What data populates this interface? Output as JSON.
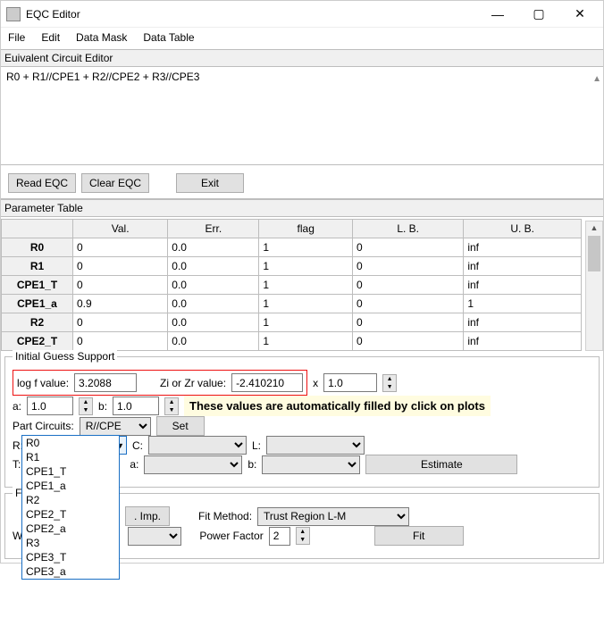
{
  "window": {
    "title": "EQC Editor"
  },
  "menu": {
    "file": "File",
    "edit": "Edit",
    "dataMask": "Data Mask",
    "dataTable": "Data Table"
  },
  "eqc": {
    "section": "Euivalent Circuit Editor",
    "expression": "R0 + R1//CPE1 + R2//CPE2 + R3//CPE3",
    "read": "Read EQC",
    "clear": "Clear EQC",
    "exit": "Exit"
  },
  "paramTable": {
    "section": "Parameter Table",
    "headers": {
      "val": "Val.",
      "err": "Err.",
      "flag": "flag",
      "lb": "L. B.",
      "ub": "U. B."
    },
    "rows": [
      {
        "name": "R0",
        "val": "0",
        "err": "0.0",
        "flag": "1",
        "lb": "0",
        "ub": "inf"
      },
      {
        "name": "R1",
        "val": "0",
        "err": "0.0",
        "flag": "1",
        "lb": "0",
        "ub": "inf"
      },
      {
        "name": "CPE1_T",
        "val": "0",
        "err": "0.0",
        "flag": "1",
        "lb": "0",
        "ub": "inf"
      },
      {
        "name": "CPE1_a",
        "val": "0.9",
        "err": "0.0",
        "flag": "1",
        "lb": "0",
        "ub": "1"
      },
      {
        "name": "R2",
        "val": "0",
        "err": "0.0",
        "flag": "1",
        "lb": "0",
        "ub": "inf"
      },
      {
        "name": "CPE2_T",
        "val": "0",
        "err": "0.0",
        "flag": "1",
        "lb": "0",
        "ub": "inf"
      }
    ]
  },
  "guess": {
    "section": "Initial Guess Support",
    "logfLabel": "log f value:",
    "logf": "3.2088",
    "zLabel": "Zi or Zr value:",
    "z": "-2.410210",
    "xLabel": "x",
    "x": "1.0",
    "aLabel": "a:",
    "a": "1.0",
    "bLabel": "b:",
    "b": "1.0",
    "annotation": "These values are automatically filled by click on plots",
    "partLabel": "Part Circuits:",
    "partValue": "R//CPE",
    "set": "Set",
    "RLabel": "R:",
    "CLabel": "C:",
    "LLabel": "L:",
    "TLabel": "T:",
    "a2Label": "a:",
    "b2Label": "b:",
    "estimate": "Estimate",
    "dropdown": [
      "R0",
      "R1",
      "CPE1_T",
      "CPE1_a",
      "R2",
      "CPE2_T",
      "CPE2_a",
      "R3",
      "CPE3_T",
      "CPE3_a"
    ]
  },
  "fit": {
    "section": "Fittin",
    "impBtn": ". Imp.",
    "methodLabel": "Fit Method:",
    "method": "Trust Region L-M",
    "wLabel": "W",
    "pfLabel": "Power Factor",
    "pf": "2",
    "fit": "Fit"
  }
}
